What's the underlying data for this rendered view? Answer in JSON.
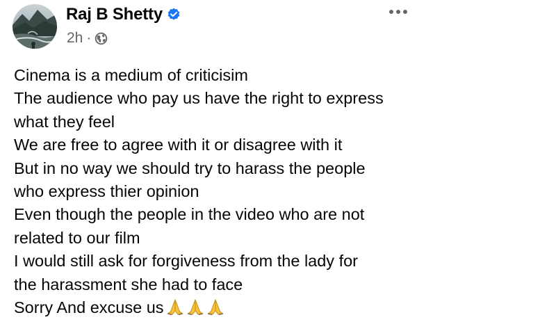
{
  "post": {
    "author": {
      "name": "Raj B Shetty",
      "verified": true
    },
    "meta": {
      "time": "2h",
      "separator": "·",
      "audience_icon": "globe-icon"
    },
    "options_icon": "more-horizontal-icon",
    "lines": [
      "Cinema is a medium of criticisim",
      "The audience who pay us have the right to express",
      "what they feel",
      "We are free to agree with it or disagree with it",
      "But in no way we should try to harass the people",
      "who express thier opinion",
      "Even though the people in the video who are not",
      "related to our film",
      "I would still ask for forgiveness from the lady for",
      "the harassment she had to face",
      "Sorry And excuse us"
    ],
    "closing_emoji": "folded-hands-icon",
    "closing_emoji_count": 3
  },
  "colors": {
    "text": "#050505",
    "secondary_text": "#65676b",
    "verified_badge": "#1877f2",
    "emoji_yellow": "#f6c33b"
  }
}
